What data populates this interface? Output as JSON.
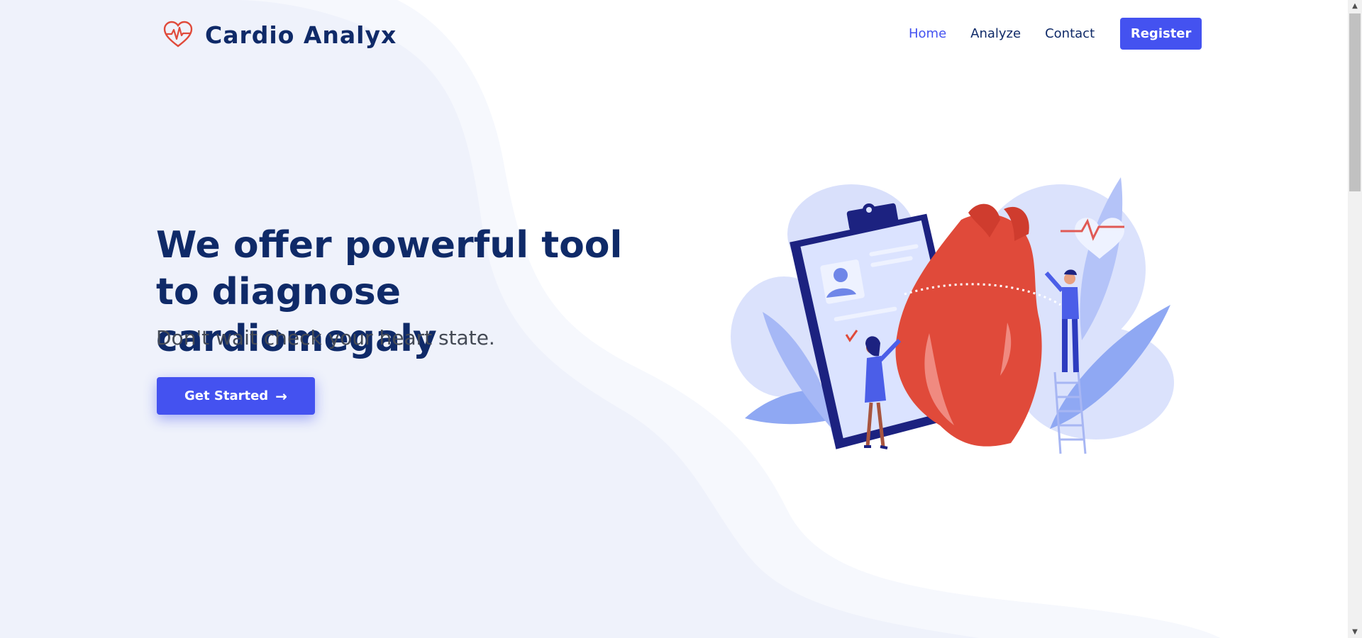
{
  "brand": {
    "name": "Cardio Analyx",
    "icon": "heart-pulse-icon",
    "icon_color": "#e04a3a"
  },
  "nav": {
    "items": [
      {
        "label": "Home",
        "active": true
      },
      {
        "label": "Analyze",
        "active": false
      },
      {
        "label": "Contact",
        "active": false
      }
    ],
    "register_label": "Register"
  },
  "hero": {
    "title": "We offer powerful tool to diagnose cardiomegaly",
    "subtitle": "Don't wait check your heart state.",
    "cta_label": "Get Started",
    "cta_icon": "arrow-right-icon"
  },
  "colors": {
    "primary": "#4452f0",
    "heading": "#0f2a68",
    "background_wave": "#eff2fb",
    "illustration_red": "#e04a3a"
  },
  "scrollbar": {
    "up_icon": "scroll-up-arrow-icon",
    "down_icon": "scroll-down-arrow-icon"
  }
}
